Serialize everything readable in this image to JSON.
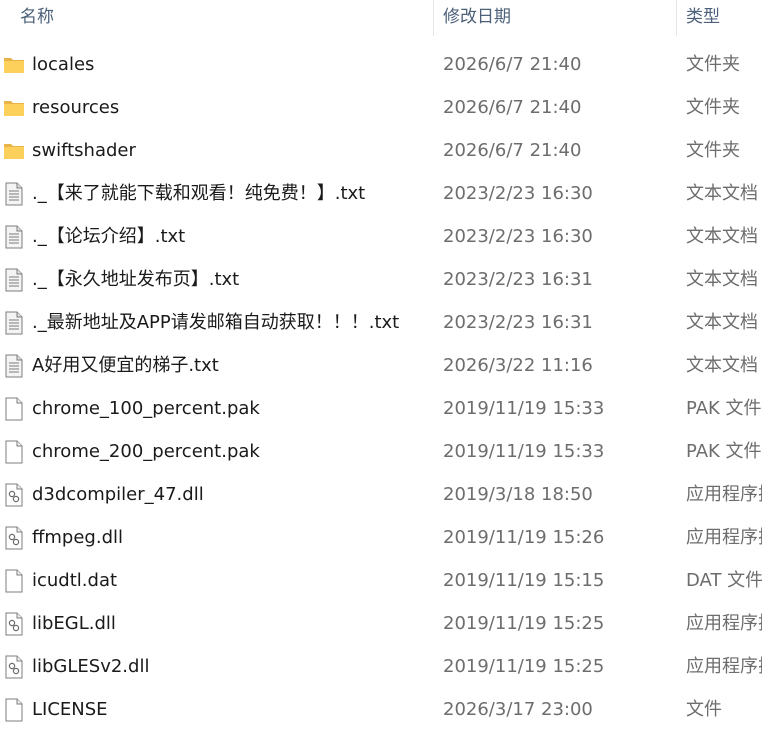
{
  "columns": {
    "name": "名称",
    "date": "修改日期",
    "type": "类型"
  },
  "files": [
    {
      "icon": "folder-icon",
      "name": "locales",
      "date": "2026/6/7 21:40",
      "type": "文件夹"
    },
    {
      "icon": "folder-icon",
      "name": "resources",
      "date": "2026/6/7 21:40",
      "type": "文件夹"
    },
    {
      "icon": "folder-icon",
      "name": "swiftshader",
      "date": "2026/6/7 21:40",
      "type": "文件夹"
    },
    {
      "icon": "text-file-icon",
      "name": "._【来了就能下载和观看！纯免费！】.txt",
      "date": "2023/2/23 16:30",
      "type": "文本文档"
    },
    {
      "icon": "text-file-icon",
      "name": "._【论坛介绍】.txt",
      "date": "2023/2/23 16:30",
      "type": "文本文档"
    },
    {
      "icon": "text-file-icon",
      "name": "._【永久地址发布页】.txt",
      "date": "2023/2/23 16:31",
      "type": "文本文档"
    },
    {
      "icon": "text-file-icon",
      "name": "._最新地址及APP请发邮箱自动获取！！！.txt",
      "date": "2023/2/23 16:31",
      "type": "文本文档"
    },
    {
      "icon": "text-file-icon",
      "name": "A好用又便宜的梯子.txt",
      "date": "2026/3/22 11:16",
      "type": "文本文档"
    },
    {
      "icon": "blank-file-icon",
      "name": "chrome_100_percent.pak",
      "date": "2019/11/19 15:33",
      "type": "PAK 文件"
    },
    {
      "icon": "blank-file-icon",
      "name": "chrome_200_percent.pak",
      "date": "2019/11/19 15:33",
      "type": "PAK 文件"
    },
    {
      "icon": "dll-file-icon",
      "name": "d3dcompiler_47.dll",
      "date": "2019/3/18 18:50",
      "type": "应用程序扩展"
    },
    {
      "icon": "dll-file-icon",
      "name": "ffmpeg.dll",
      "date": "2019/11/19 15:26",
      "type": "应用程序扩展"
    },
    {
      "icon": "blank-file-icon",
      "name": "icudtl.dat",
      "date": "2019/11/19 15:15",
      "type": "DAT 文件"
    },
    {
      "icon": "dll-file-icon",
      "name": "libEGL.dll",
      "date": "2019/11/19 15:25",
      "type": "应用程序扩展"
    },
    {
      "icon": "dll-file-icon",
      "name": "libGLESv2.dll",
      "date": "2019/11/19 15:25",
      "type": "应用程序扩展"
    },
    {
      "icon": "blank-file-icon",
      "name": "LICENSE",
      "date": "2026/3/17 23:00",
      "type": "文件"
    }
  ]
}
